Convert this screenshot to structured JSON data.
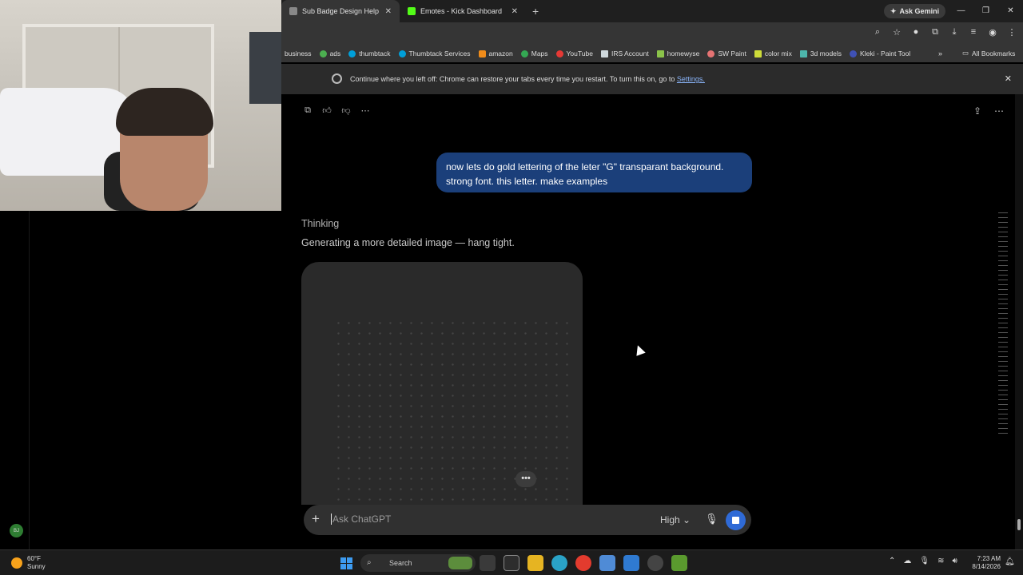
{
  "browser": {
    "tabs": [
      {
        "title": "Sub Badge Design Help",
        "active": true
      },
      {
        "title": "Emotes - Kick Dashboard",
        "active": false
      }
    ],
    "new_tab_symbol": "+",
    "ask_gemini": "Ask Gemini",
    "bookmarks": [
      {
        "label": "business"
      },
      {
        "label": "ads"
      },
      {
        "label": "thumbtack"
      },
      {
        "label": "Thumbtack Services"
      },
      {
        "label": "amazon"
      },
      {
        "label": "Maps"
      },
      {
        "label": "YouTube"
      },
      {
        "label": "IRS Account"
      },
      {
        "label": "homewyse"
      },
      {
        "label": "SW Paint"
      },
      {
        "label": "color mix"
      },
      {
        "label": "3d models"
      },
      {
        "label": "Kleki - Paint Tool"
      }
    ],
    "all_bookmarks": "All Bookmarks",
    "infobar": {
      "message": "Continue where you left off: Chrome can restore your tabs every time you restart. To turn this on, go to",
      "link": "Settings."
    }
  },
  "chat": {
    "user_message": "now lets do gold lettering of the leter \"G\" transparant background. strong font. this letter. make examples",
    "thinking_label": "Thinking",
    "status": "Generating a more detailed image — hang tight.",
    "more_label": "•••",
    "composer": {
      "placeholder": "Ask ChatGPT",
      "model_mode": "High"
    }
  },
  "sidebar": {
    "avatar_initials": "BJ"
  },
  "taskbar": {
    "weather_temp": "60°F",
    "weather_cond": "Sunny",
    "search_label": "Search",
    "time": "7:23 AM",
    "date": "8/14/2026"
  }
}
